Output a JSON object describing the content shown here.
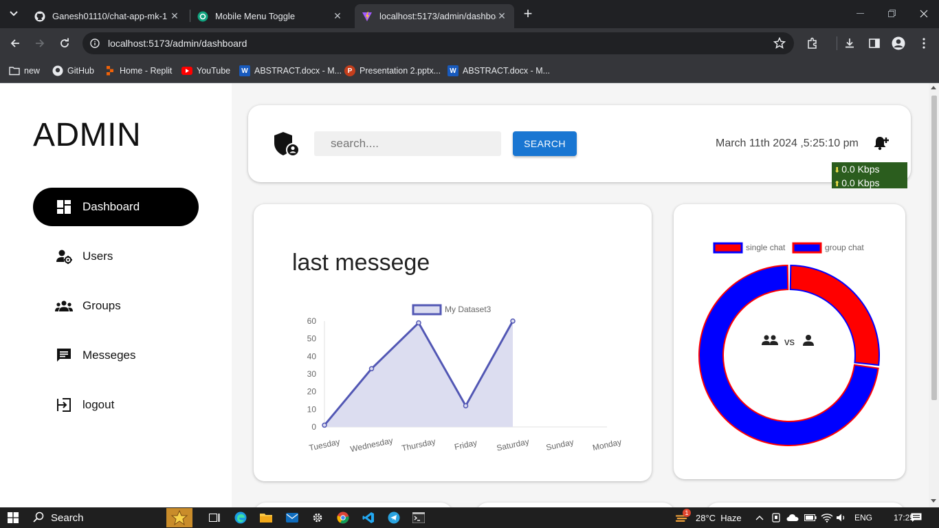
{
  "browser": {
    "tabs": [
      {
        "title": "Ganesh01110/chat-app-mk-1",
        "close": "✕"
      },
      {
        "title": "Mobile Menu Toggle",
        "close": "✕"
      },
      {
        "title": "localhost:5173/admin/dashboard",
        "close": "✕"
      }
    ],
    "new_tab": "+",
    "url": "localhost:5173/admin/dashboard",
    "bookmarks": [
      "new",
      "GitHub",
      "Home - Replit",
      "YouTube",
      "ABSTRACT.docx - M...",
      "Presentation 2.pptx...",
      "ABSTRACT.docx - M..."
    ]
  },
  "sidebar": {
    "brand": "ADMIN",
    "items": [
      {
        "label": "Dashboard",
        "icon": "dashboard-icon",
        "active": true
      },
      {
        "label": "Users",
        "icon": "manage-accounts-icon",
        "active": false
      },
      {
        "label": "Groups",
        "icon": "groups-icon",
        "active": false
      },
      {
        "label": "Messeges",
        "icon": "message-icon",
        "active": false
      },
      {
        "label": "logout",
        "icon": "logout-icon",
        "active": false
      }
    ]
  },
  "header": {
    "search_placeholder": "search....",
    "search_button": "SEARCH",
    "datetime": "March 11th 2024 ,5:25:10 pm"
  },
  "netspeed": {
    "down": "0.0 Kbps",
    "up": "0.0 Kbps"
  },
  "line_card": {
    "title": "last messege"
  },
  "doughnut_card": {
    "center_vs": "vs"
  },
  "colors": {
    "line": "#5257b4",
    "line_fill": "#dcddf0",
    "single": "#ff0000",
    "group": "#0000ff",
    "active_nav": "#000000",
    "search_button": "#1976d2"
  },
  "chart_data": [
    {
      "type": "line",
      "title": "",
      "categories": [
        "Tuesday",
        "Wednesday",
        "Thursday",
        "Friday",
        "Saturday",
        "Sunday",
        "Monday"
      ],
      "series": [
        {
          "name": "My Dataset3",
          "values": [
            1,
            33,
            59,
            12,
            60
          ]
        }
      ],
      "ylim": [
        0,
        60
      ],
      "yticks": [
        0,
        10,
        20,
        30,
        40,
        50,
        60
      ],
      "fill": true,
      "legend": "top"
    },
    {
      "type": "pie",
      "subtype": "doughnut",
      "labels": [
        "single chat",
        "group chat"
      ],
      "values": [
        27,
        73
      ],
      "colors": [
        "#ff0000",
        "#0000ff"
      ],
      "legend": "top"
    }
  ],
  "taskbar": {
    "search": "Search",
    "weather": "28°C  Haze",
    "lang": "ENG",
    "time": "17:25",
    "badge": "1"
  }
}
